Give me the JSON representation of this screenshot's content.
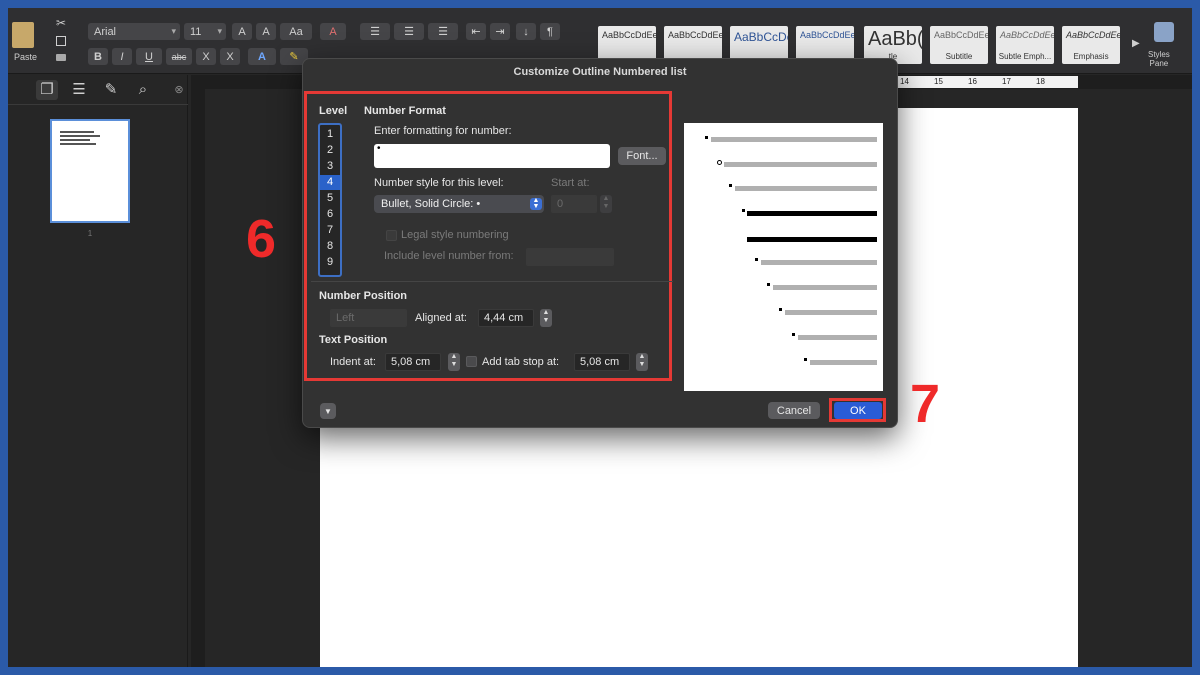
{
  "ribbon": {
    "paste_label": "Paste",
    "font_name": "Arial",
    "font_size": "11",
    "styles_pane_label": "Styles\nPane",
    "style_tiles": [
      {
        "sample": "AaBbCcDdEe",
        "name": ""
      },
      {
        "sample": "AaBbCcDdEe",
        "name": ""
      },
      {
        "sample": "AaBbCcDc",
        "name": ""
      },
      {
        "sample": "AaBbCcDdEe",
        "name": ""
      },
      {
        "sample": "AaBb(",
        "name": "tle"
      },
      {
        "sample": "AaBbCcDdEe",
        "name": "Subtitle"
      },
      {
        "sample": "AaBbCcDdEe",
        "name": "Subtle Emph..."
      },
      {
        "sample": "AaBbCcDdEe",
        "name": "Emphasis"
      }
    ]
  },
  "sidebar": {
    "page_number": "1"
  },
  "ruler": {
    "ticks": [
      "14",
      "15",
      "16",
      "17",
      "18"
    ]
  },
  "dialog": {
    "title": "Customize Outline Numbered list",
    "level_header": "Level",
    "levels": [
      "1",
      "2",
      "3",
      "4",
      "5",
      "6",
      "7",
      "8",
      "9"
    ],
    "selected_level": "4",
    "number_format_header": "Number Format",
    "enter_formatting_label": "Enter formatting for number:",
    "format_value": "•",
    "font_button": "Font...",
    "number_style_label": "Number style for this level:",
    "number_style_value": "Bullet, Solid Circle: •",
    "start_at_label": "Start at:",
    "start_at_value": "0",
    "legal_style_label": "Legal style numbering",
    "include_level_label": "Include level number from:",
    "number_position_header": "Number Position",
    "alignment_value": "Left",
    "aligned_at_label": "Aligned at:",
    "aligned_at_value": "4,44 cm",
    "text_position_header": "Text Position",
    "indent_at_label": "Indent at:",
    "indent_at_value": "5,08 cm",
    "add_tab_stop_label": "Add tab stop at:",
    "tab_stop_value": "5,08 cm",
    "cancel_button": "Cancel",
    "ok_button": "OK",
    "expand_icon": "chevron-down-icon"
  },
  "annotations": {
    "step6": "6",
    "step7": "7"
  },
  "colors": {
    "highlight_red": "#e53935",
    "accent_blue": "#2a5cd6",
    "frame_blue": "#2b5aa8"
  }
}
